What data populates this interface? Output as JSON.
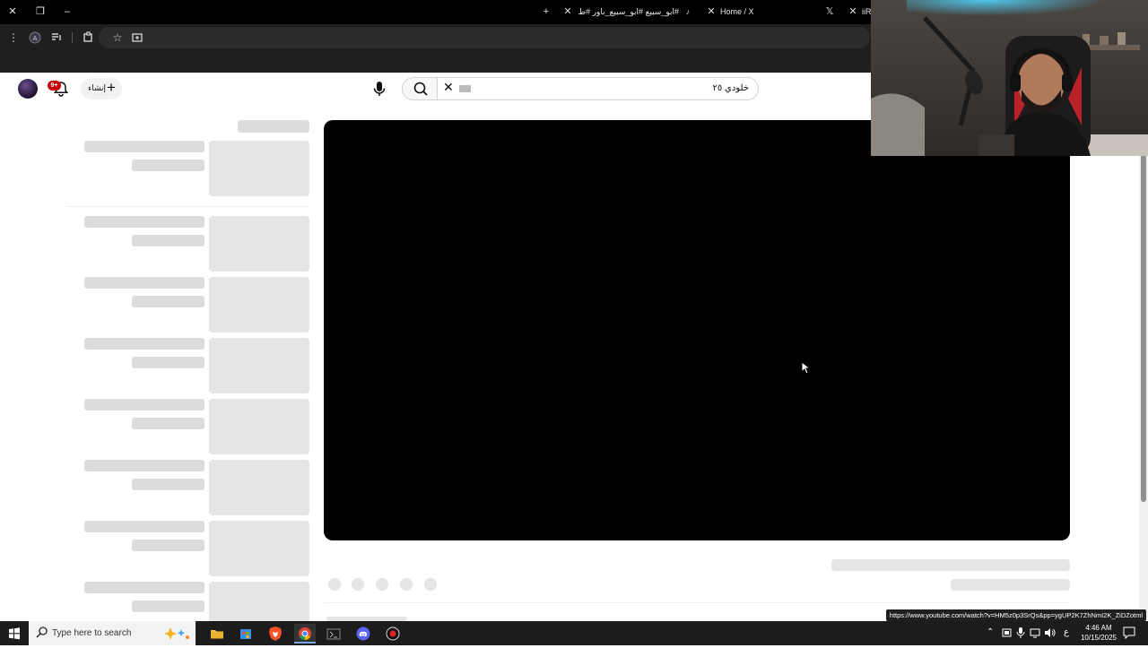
{
  "browser": {
    "tabs": [
      {
        "title": "#ابو_سبيع #ابو_سبيع_باور #طلو...",
        "icon": "tiktok-icon"
      },
      {
        "title": "Home / X",
        "icon": "x-logo-icon"
      },
      {
        "title": "iiR",
        "icon": "tab-icon"
      }
    ],
    "status_url": "https://www.youtube.com/watch?v=HM5z0p3SrQs&pp=ygUP2K7ZhNmI2K_ZiDZotml"
  },
  "youtube": {
    "create_label": "إنشاء",
    "notification_count": "9+",
    "search": {
      "query": "خلودي ٢٥"
    }
  },
  "taskbar": {
    "search_placeholder": "Type here to search",
    "language": "ع",
    "time": "4:46 AM",
    "date": "10/15/2025"
  },
  "colors": {
    "notification_badge": "#cc0000",
    "player_background": "#000000",
    "skeleton": "#e5e5e5"
  }
}
